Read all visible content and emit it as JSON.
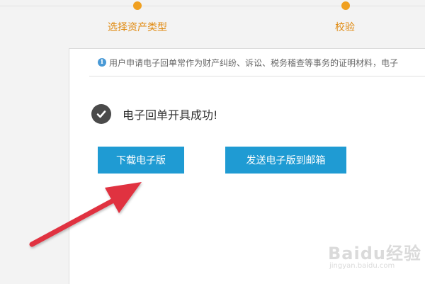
{
  "steps": [
    {
      "label": "选择资产类型"
    },
    {
      "label": "校验"
    }
  ],
  "notice": {
    "icon": "info-icon",
    "text": "用户申请电子回单常作为财产纠纷、诉讼、税务稽查等事务的证明材料，电子"
  },
  "result": {
    "icon": "check-circle-icon",
    "message": "电子回单开具成功!"
  },
  "buttons": {
    "download": "下载电子版",
    "email": "发送电子版到邮箱"
  },
  "colors": {
    "accent": "#1f9bd3",
    "step": "#e08a10",
    "arrow": "#e03040"
  },
  "watermark": {
    "brand": "Baidu经验",
    "url": "jingyan.baidu.com"
  }
}
